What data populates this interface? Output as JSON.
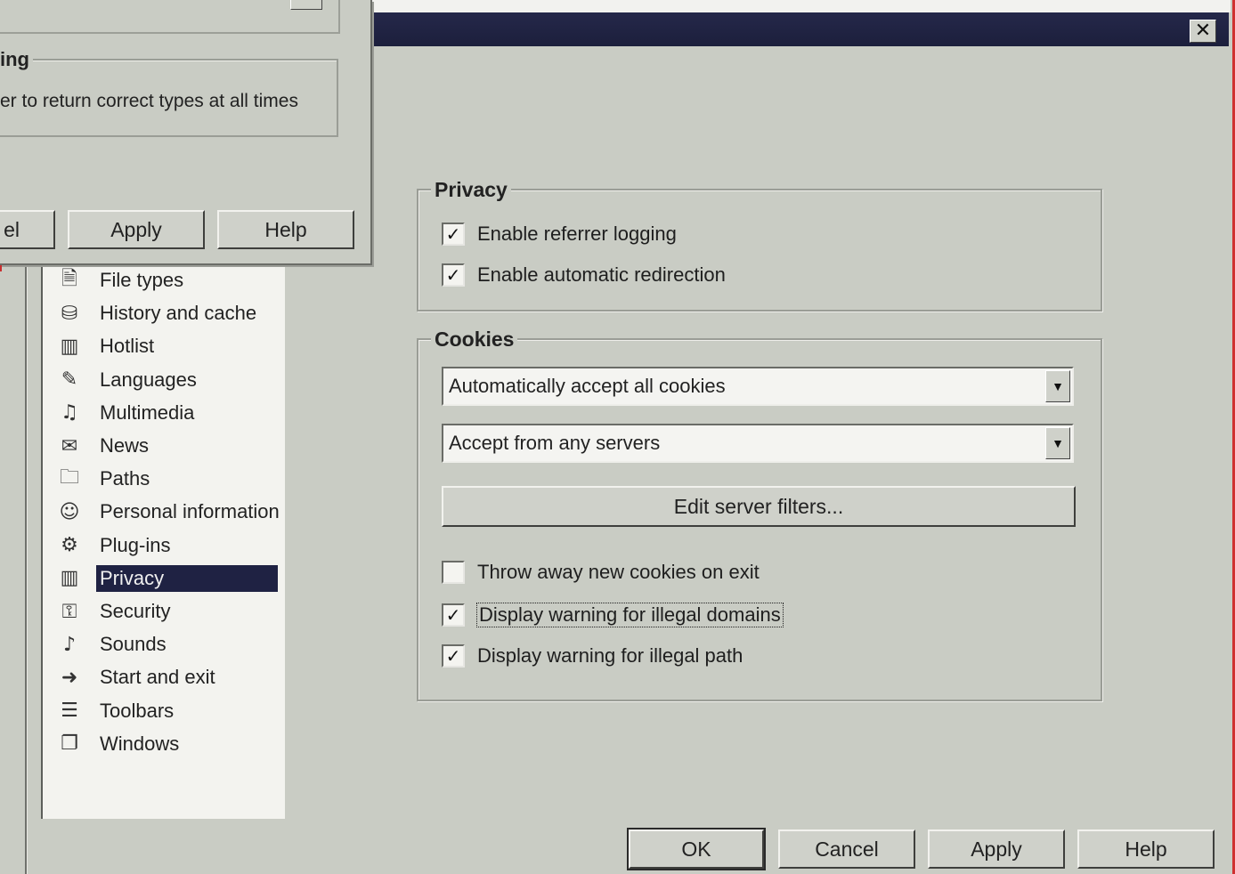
{
  "back_dialog": {
    "group_title": "ing",
    "group_text": "er to return correct types at all times",
    "buttons": {
      "cancel": "el",
      "apply": "Apply",
      "help": "Help"
    }
  },
  "dialog": {
    "close_glyph": "✕",
    "categories": [
      {
        "label": "File types",
        "icon": "file-types-icon"
      },
      {
        "label": "History and cache",
        "icon": "history-cache-icon"
      },
      {
        "label": "Hotlist",
        "icon": "hotlist-icon"
      },
      {
        "label": "Languages",
        "icon": "languages-icon"
      },
      {
        "label": "Multimedia",
        "icon": "multimedia-icon"
      },
      {
        "label": "News",
        "icon": "news-icon"
      },
      {
        "label": "Paths",
        "icon": "paths-folder-icon"
      },
      {
        "label": "Personal information",
        "icon": "personal-info-icon"
      },
      {
        "label": "Plug-ins",
        "icon": "plugins-icon"
      },
      {
        "label": "Privacy",
        "icon": "privacy-icon"
      },
      {
        "label": "Security",
        "icon": "security-icon"
      },
      {
        "label": "Sounds",
        "icon": "sounds-icon"
      },
      {
        "label": "Start and exit",
        "icon": "start-exit-icon"
      },
      {
        "label": "Toolbars",
        "icon": "toolbars-icon"
      },
      {
        "label": "Windows",
        "icon": "windows-icon"
      }
    ],
    "selected_category": "Privacy",
    "privacy_group": {
      "title": "Privacy",
      "enable_referrer_logging": "Enable referrer logging",
      "enable_automatic_redirection": "Enable automatic redirection"
    },
    "cookies_group": {
      "title": "Cookies",
      "accept_mode": "Automatically accept all cookies",
      "server_mode": "Accept from any servers",
      "edit_filters": "Edit server filters...",
      "throw_away": "Throw away new cookies on exit",
      "warn_domains": "Display warning for illegal domains",
      "warn_path": "Display warning for illegal path"
    },
    "checks": {
      "referrer": true,
      "redirection": true,
      "throw_away": false,
      "warn_domains": true,
      "warn_path": true
    },
    "buttons": {
      "ok": "OK",
      "cancel": "Cancel",
      "apply": "Apply",
      "help": "Help"
    }
  }
}
